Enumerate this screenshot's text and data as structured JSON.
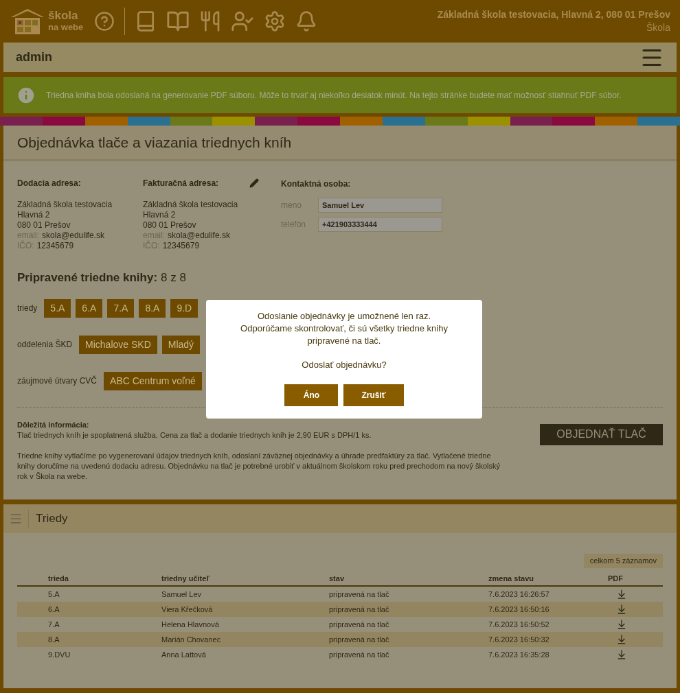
{
  "header": {
    "logo_line1": "škola",
    "logo_line2": "na webe",
    "school": "Základná škola testovacia, Hlavná 2, 080 01 Prešov",
    "role": "Škola"
  },
  "user_bar": {
    "name": "admin"
  },
  "notice": {
    "text": "Triedna kniha bola odoslaná na generovanie PDF súboru. Môže to trvať aj niekoľko desiatok minút. Na tejto stránke budete mať možnosť stiahnuť PDF súbor."
  },
  "order": {
    "title": "Objednávka tlače a viazania triednych kníh",
    "addresses": [
      {
        "heading": "Dodacia adresa:",
        "editable": false,
        "lines": [
          "Základná škola testovacia",
          "Hlavná 2",
          "080 01 Prešov"
        ],
        "email_label": "email:",
        "email": "skola@edulife.sk",
        "ico_label": "IČO:",
        "ico": "12345679"
      },
      {
        "heading": "Fakturačná adresa:",
        "editable": true,
        "lines": [
          "Základná škola testovacia",
          "Hlavná 2",
          "080 01 Prešov"
        ],
        "email_label": "email:",
        "email": "skola@edulife.sk",
        "ico_label": "IČO:",
        "ico": "12345679"
      }
    ],
    "contact": {
      "heading": "Kontaktná osoba:",
      "fields": [
        {
          "label": "meno",
          "value": "Samuel Lev"
        },
        {
          "label": "telefón",
          "value": "+421903333444"
        }
      ]
    },
    "prepared": {
      "label": "Pripravené triedne knihy:",
      "count": "8 z 8"
    },
    "groups": [
      {
        "label": "triedy",
        "items": [
          "5.A",
          "6.A",
          "7.A",
          "8.A",
          "9.D"
        ]
      },
      {
        "label": "oddelenia ŠKD",
        "items": [
          "Michalove SKD",
          "Mladý"
        ]
      },
      {
        "label": "záujmové útvary CVČ",
        "items": [
          "ABC Centrum voľné"
        ]
      }
    ],
    "info_heading": "Dôležitá informácia:",
    "info_paragraphs": [
      "Tlač triednych kníh je spoplatnená služba. Cena za tlač a dodanie triednych kníh je 2,90 EUR s DPH/1 ks.",
      "Triedne knihy vytlačíme po vygenerovaní údajov triednych kníh, odoslaní záväznej objednávky a úhrade predfaktúry za tlač. Vytlačené triedne knihy doručíme na uvedenú dodaciu adresu. Objednávku na tlač je potrebné urobiť v aktuálnom školskom roku pred prechodom na nový školský rok v Škola na webe."
    ],
    "order_button": "OBJEDNAŤ TLAČ"
  },
  "dialog": {
    "message": "Odoslanie objednávky je umožnené len raz. Odporúčame skontrolovať, či sú všetky triedne knihy pripravené na tlač.",
    "question": "Odoslať objednávku?",
    "buttons": [
      "Áno",
      "Zrušiť"
    ]
  },
  "classes": {
    "title": "Triedy",
    "count": "celkom 5 záznamov",
    "columns": [
      "trieda",
      "triedny učiteľ",
      "stav",
      "zmena stavu",
      "PDF"
    ],
    "rows": [
      [
        "5.A",
        "Samuel Lev",
        "pripravená na tlač",
        "7.6.2023 16:26:57"
      ],
      [
        "6.A",
        "Viera Křečková",
        "pripravená na tlač",
        "7.6.2023 16:50:16"
      ],
      [
        "7.A",
        "Helena Hlavnová",
        "pripravená na tlač",
        "7.6.2023 16:50:52"
      ],
      [
        "8.A",
        "Marián Chovanec",
        "pripravená na tlač",
        "7.6.2023 16:50:32"
      ],
      [
        "9.DVU",
        "Anna Lattová",
        "pripravená na tlač",
        "7.6.2023 16:35:28"
      ]
    ]
  }
}
